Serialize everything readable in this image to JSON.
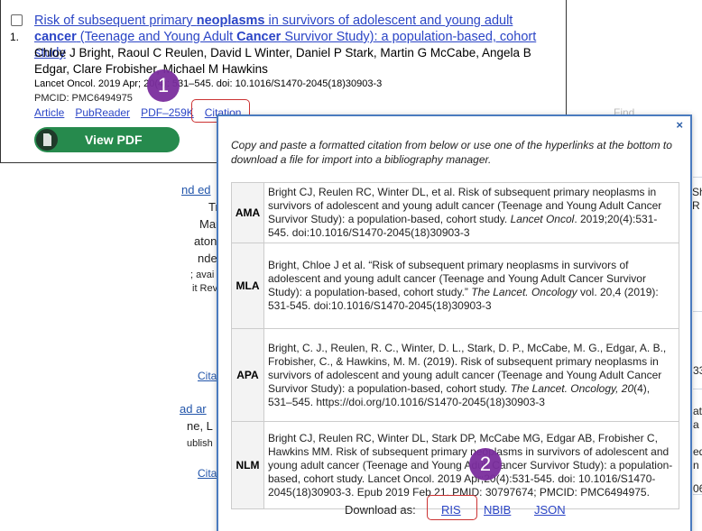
{
  "result": {
    "number": "1.",
    "title_parts": [
      {
        "text": "Risk of subsequent primary ",
        "bold": false
      },
      {
        "text": "neoplasms",
        "bold": true
      },
      {
        "text": " in survivors of adolescent and young adult ",
        "bold": false
      },
      {
        "text": "cancer",
        "bold": true
      },
      {
        "text": " (Teenage and Young Adult ",
        "bold": false
      },
      {
        "text": "Cancer",
        "bold": true
      },
      {
        "text": " Survivor Study): a population-based, cohort study",
        "bold": false
      }
    ],
    "authors": "Chloe J Bright, Raoul C Reulen, David L Winter, Daniel P Stark, Martin G McCabe, Angela B Edgar, Clare Frobisher, Michael M Hawkins",
    "citation_line": "Lancet Oncol. 2019 Apr; 20(4): 531–545. doi: 10.1016/S1470-2045(18)30903-3",
    "pmcid": "PMCID: PMC6494975",
    "links": {
      "article": "Article",
      "pubreader": "PubReader",
      "pdf": "PDF–259K",
      "citation": "Citation"
    },
    "view_pdf": "View PDF"
  },
  "callouts": {
    "one": "1",
    "two": "2"
  },
  "background": {
    "fragments": [
      "nd ed",
      "Trev",
      "Marc",
      "aton,",
      "nder",
      "; avai",
      "it Rev",
      "Cita",
      "ad ar",
      "ne, L",
      "ublish",
      "Cita",
      "Sh",
      "R",
      "33",
      "atu",
      "a",
      "ed",
      "n",
      "06",
      "Find"
    ]
  },
  "modal": {
    "close": "×",
    "intro": "Copy and paste a formatted citation from below or use one of the hyperlinks at the bottom to download a file for import into a bibliography manager.",
    "citations": [
      {
        "format": "AMA",
        "pre": "Bright CJ, Reulen RC, Winter DL, et al. Risk of subsequent primary neoplasms in survivors of adolescent and young adult cancer (Teenage and Young Adult Cancer Survivor Study): a population-based, cohort study. ",
        "ital": "Lancet Oncol",
        "post": ". 2019;20(4):531-545. doi:10.1016/S1470-2045(18)30903-3"
      },
      {
        "format": "MLA",
        "pre": "Bright, Chloe J et al. “Risk of subsequent primary neoplasms in survivors of adolescent and young adult cancer (Teenage and Young Adult Cancer Survivor Study): a population-based, cohort study.” ",
        "ital": "The Lancet. Oncology",
        "post": " vol. 20,4 (2019): 531-545. doi:10.1016/S1470-2045(18)30903-3"
      },
      {
        "format": "APA",
        "pre": "Bright, C. J., Reulen, R. C., Winter, D. L., Stark, D. P., McCabe, M. G., Edgar, A. B., Frobisher, C., & Hawkins, M. M. (2019). Risk of subsequent primary neoplasms in survivors of adolescent and young adult cancer (Teenage and Young Adult Cancer Survivor Study): a population-based, cohort study. ",
        "ital": "The Lancet. Oncology, 20",
        "post": "(4), 531–545. https://doi.org/10.1016/S1470-2045(18)30903-3"
      },
      {
        "format": "NLM",
        "pre": "Bright CJ, Reulen RC, Winter DL, Stark DP, McCabe MG, Edgar AB, Frobisher C, Hawkins MM. Risk of subsequent primary neoplasms in survivors of adolescent and young adult cancer (Teenage and Young Adult Cancer Survivor Study): a population-based, cohort study. Lancet Oncol. 2019 Apr;20(4):531-545. doi: 10.1016/S1470-2045(18)30903-3. Epub 2019 Feb 21. PMID: 30797674; PMCID: PMC6494975.",
        "ital": "",
        "post": ""
      }
    ],
    "download_label": "Download as:",
    "download_links": {
      "ris": "RIS",
      "nbib": "NBIB",
      "json": "JSON"
    }
  },
  "colors": {
    "link": "#2b45c6",
    "modal_border": "#4a7bbf",
    "highlight_box": "#cc3333",
    "callout": "#7b2e9e",
    "view_pdf_button": "#268a4d"
  }
}
